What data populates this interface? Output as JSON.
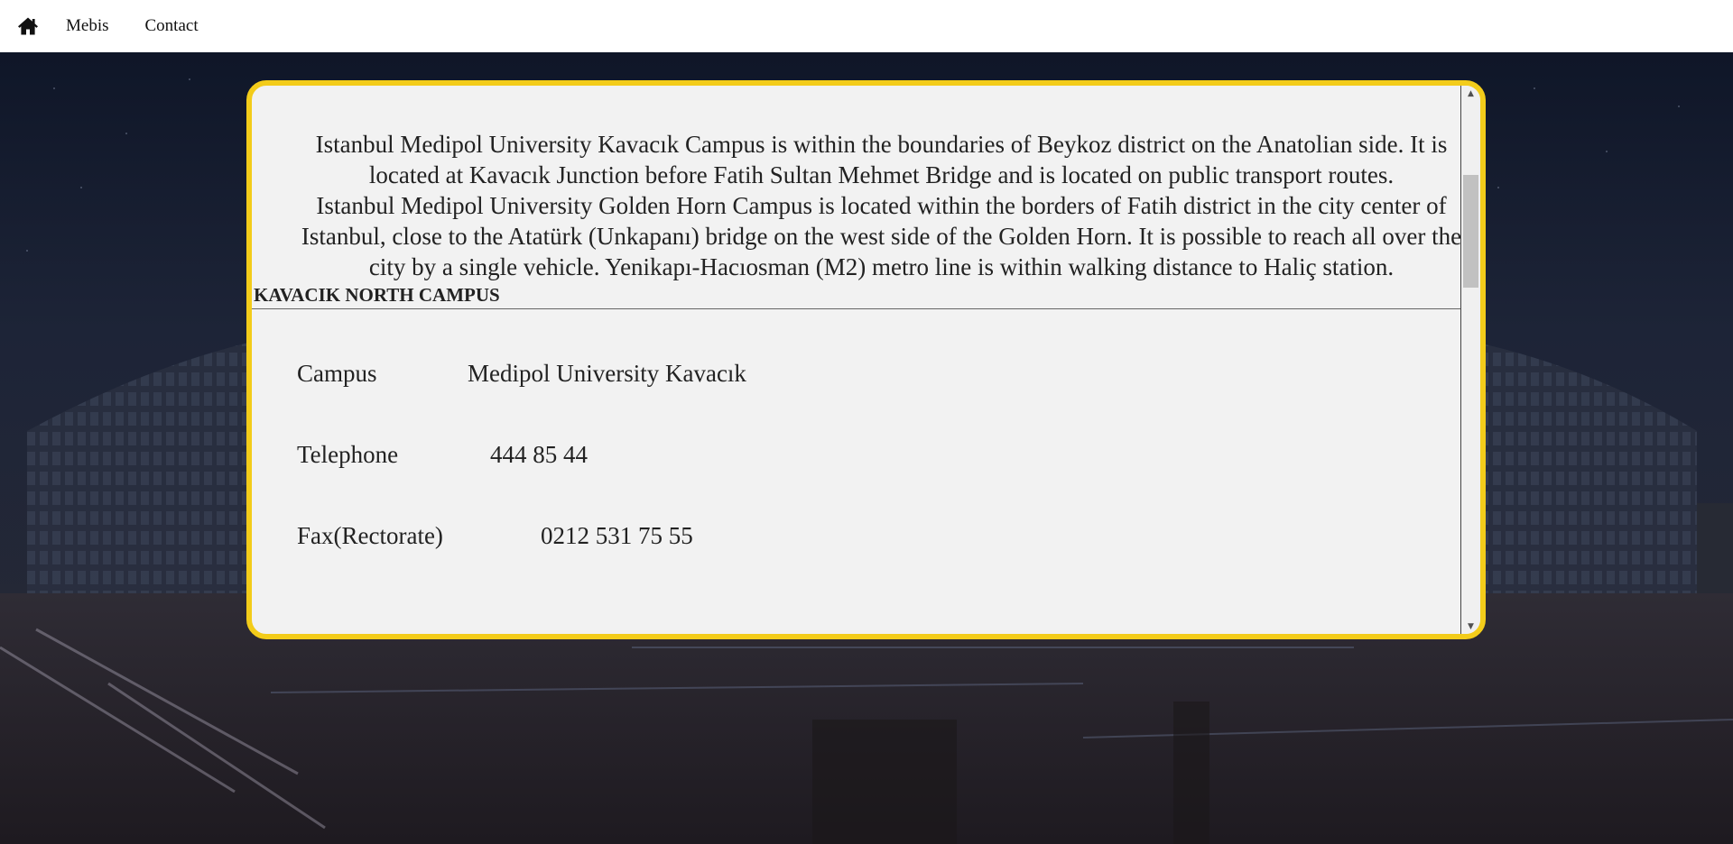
{
  "nav": {
    "home_icon": "home-icon",
    "links": [
      "Mebis",
      "Contact"
    ]
  },
  "panel": {
    "intro": [
      "Istanbul Medipol University Kavacık Campus is within the boundaries of Beykoz district on the Anatolian side. It is located at Kavacık Junction before Fatih Sultan Mehmet Bridge and is located on public transport routes.",
      "Istanbul Medipol University Golden Horn Campus is located within the borders of Fatih district in the city center of Istanbul, close to the Atatürk (Unkapanı) bridge on the west side of the Golden Horn. It is possible to reach all over the city by a single vehicle. Yenikapı-Hacıosman (M2) metro line is within walking distance to Haliç station."
    ],
    "campus_heading": "KAVACIK NORTH CAMPUS",
    "info": [
      {
        "label": "Campus",
        "value": "Medipol University Kavacık"
      },
      {
        "label": "Telephone",
        "value": "444 85 44"
      },
      {
        "label": "Fax(Rectorate)",
        "value": "0212 531 75 55"
      }
    ]
  },
  "colors": {
    "panel_border": "#f3cc1a",
    "panel_bg": "#f2f2f2",
    "navbar_bg": "#ffffff"
  }
}
